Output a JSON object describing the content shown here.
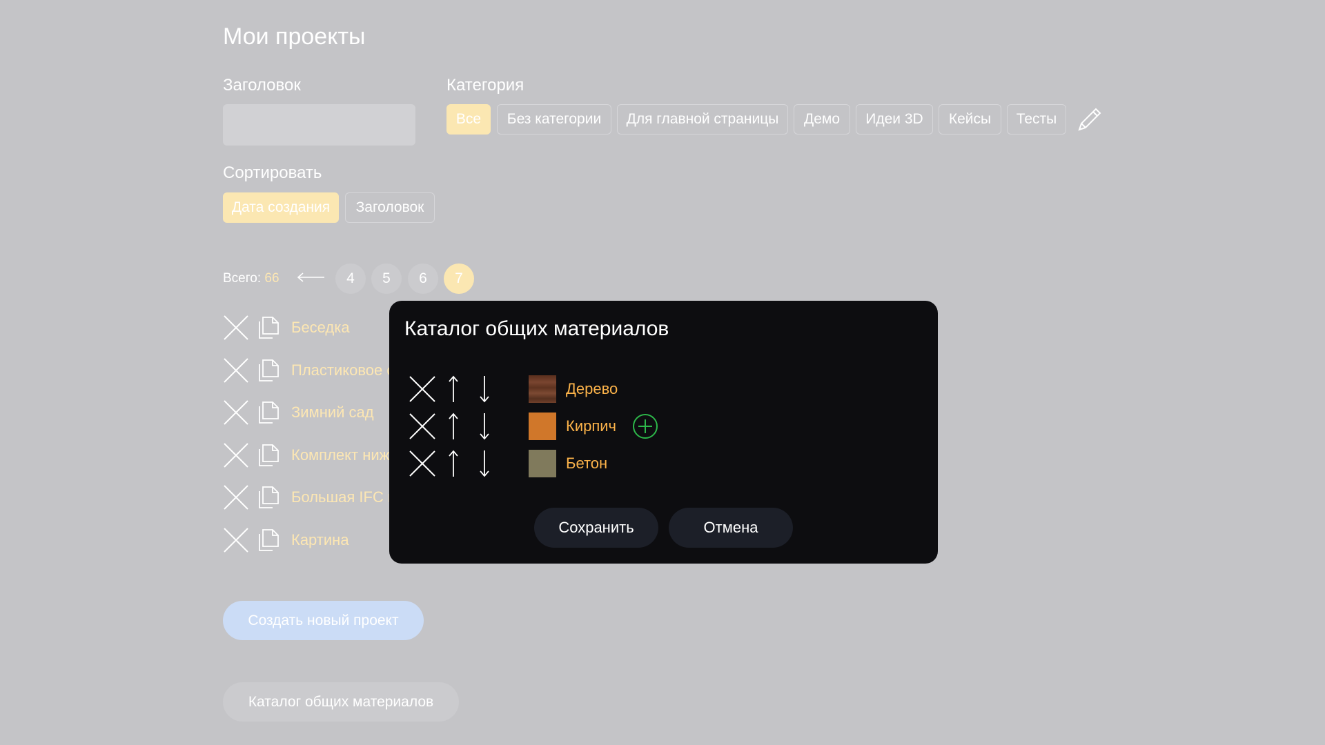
{
  "page": {
    "title": "Мои проекты"
  },
  "filters": {
    "title_label": "Заголовок",
    "title_value": "",
    "category_label": "Категория",
    "categories": [
      "Все",
      "Без категории",
      "Для главной страницы",
      "Демо",
      "Идеи 3D",
      "Кейсы",
      "Тесты"
    ],
    "category_selected": "Все",
    "sort_label": "Сортировать",
    "sort_options": [
      "Дата создания",
      "Заголовок"
    ],
    "sort_selected": "Дата создания"
  },
  "pagination": {
    "total_label": "Всего: ",
    "total_count": "66",
    "pages": [
      "4",
      "5",
      "6",
      "7"
    ],
    "current_page": "7"
  },
  "projects": [
    "Беседка",
    "Пластиковое с",
    "Зимний сад",
    "Комплект ниж",
    "Большая IFC м",
    "Картина"
  ],
  "actions": {
    "create_label": "Создать новый проект",
    "catalog_label": "Каталог общих материалов"
  },
  "modal": {
    "title": "Каталог общих материалов",
    "materials": [
      {
        "name": "Дерево",
        "color": "#6b3a25"
      },
      {
        "name": "Кирпич",
        "color": "#d0772a"
      },
      {
        "name": "Бетон",
        "color": "#807a5c"
      }
    ],
    "save_label": "Сохранить",
    "cancel_label": "Отмена"
  },
  "colors": {
    "background": "#c4c4c7",
    "accent_yellow": "#fbe7b2",
    "modal_bg": "#0d0d10",
    "material_name": "#fcb34a",
    "add_green": "#2db84a"
  }
}
